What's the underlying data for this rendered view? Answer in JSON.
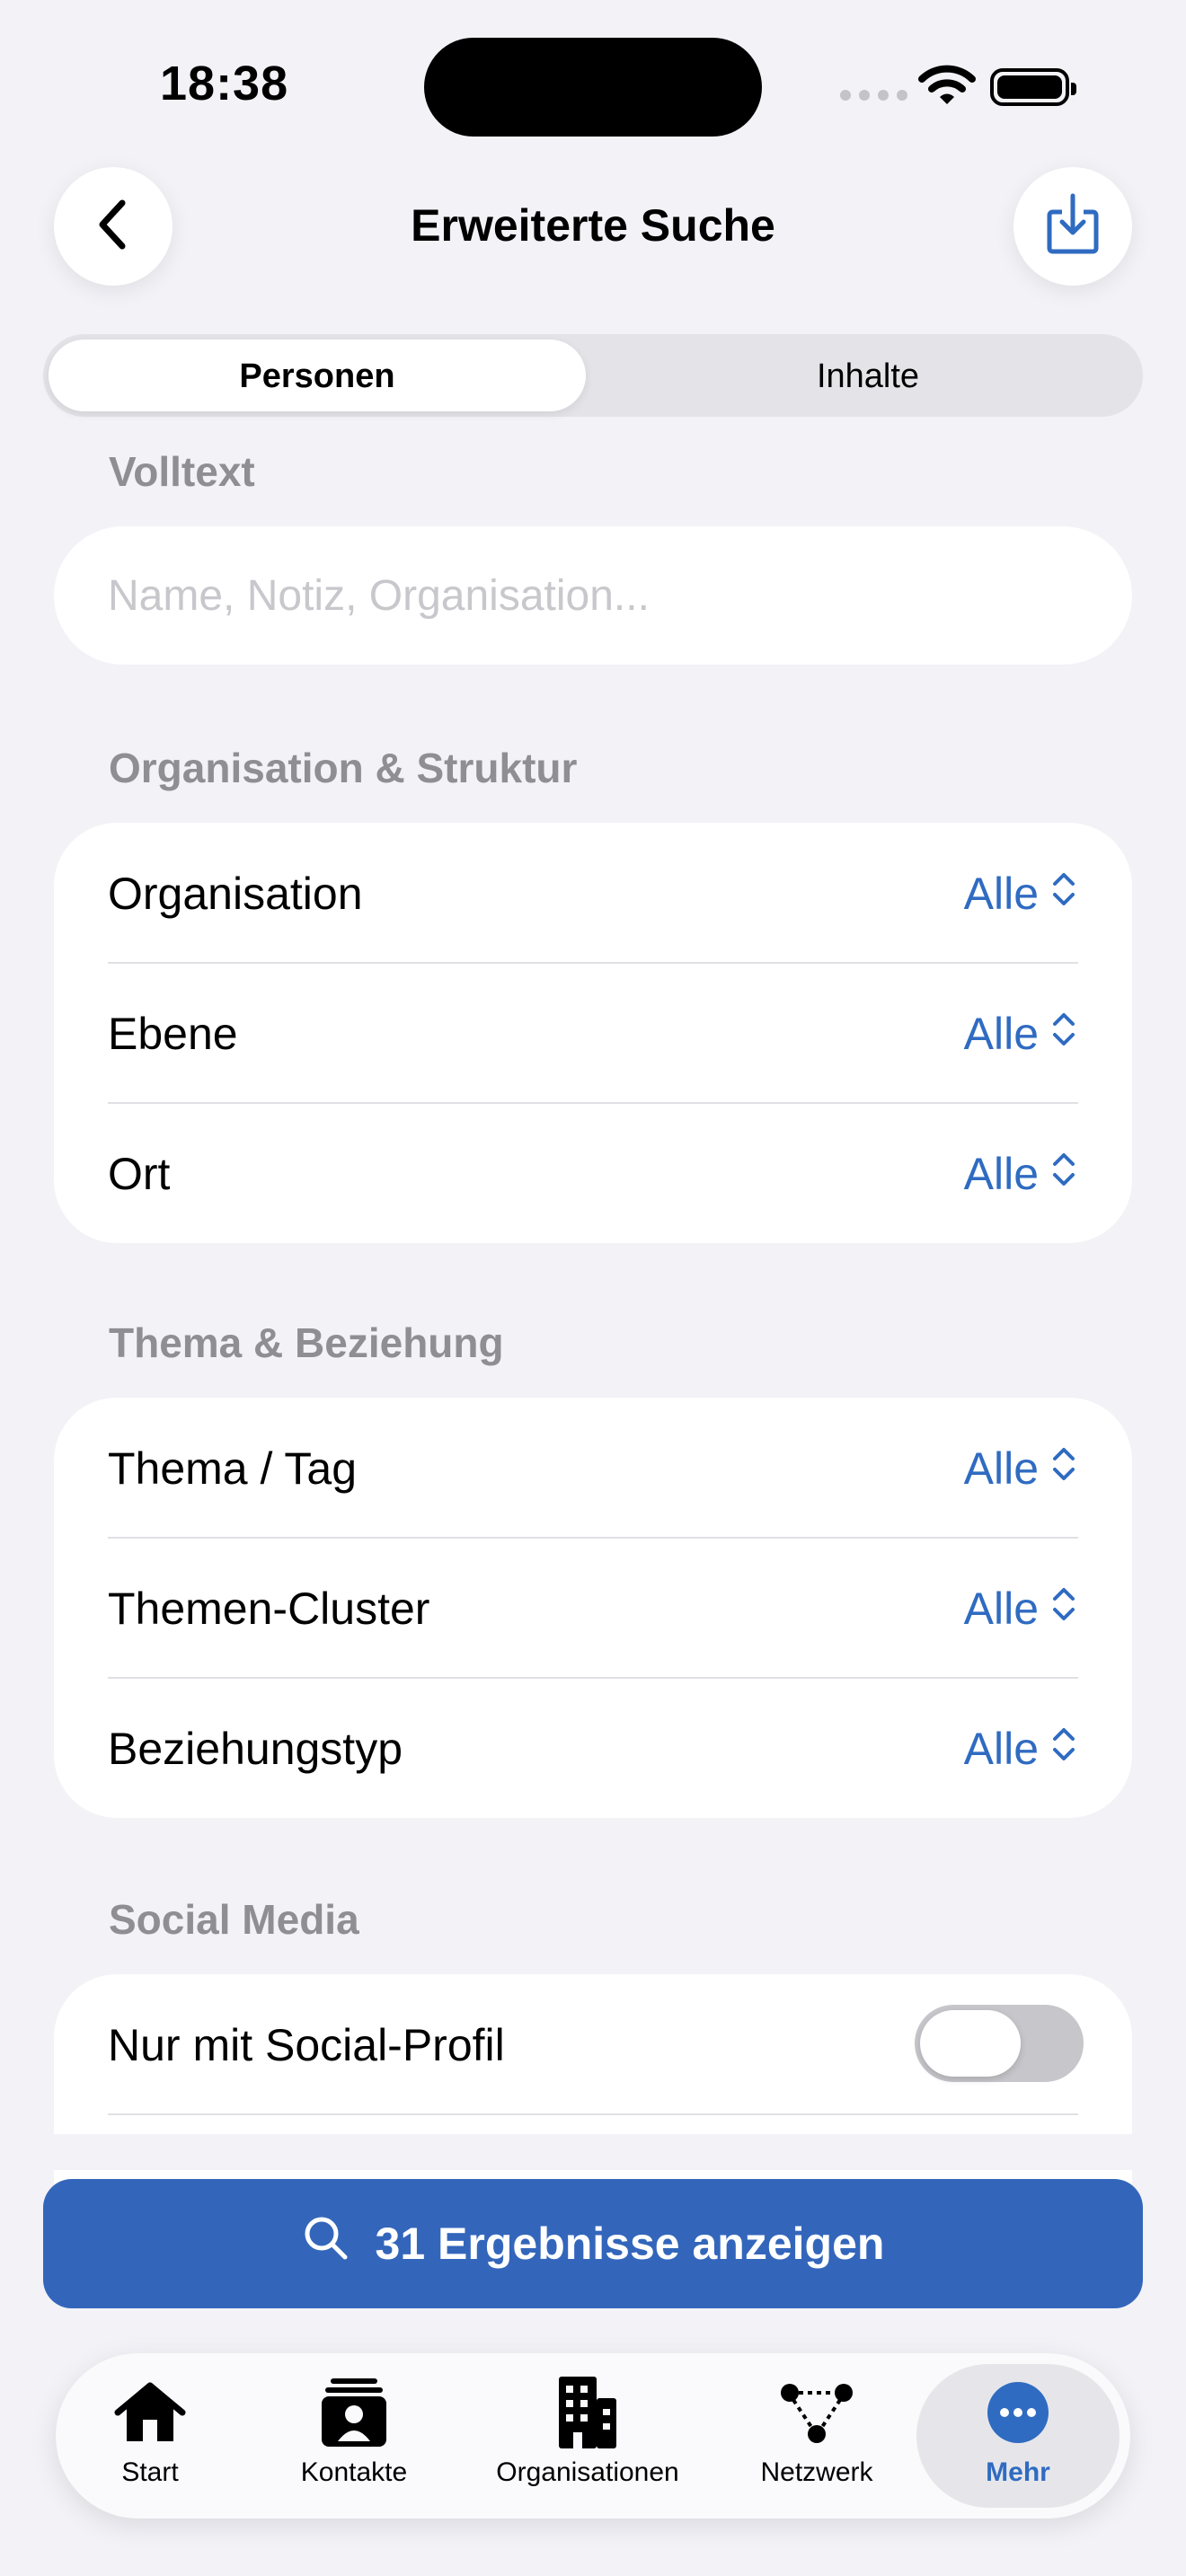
{
  "status_bar": {
    "time": "18:38"
  },
  "nav": {
    "title": "Erweiterte Suche",
    "back_icon": "chevron-left-icon",
    "export_icon": "tray-arrow-down-icon"
  },
  "segments": {
    "items": [
      {
        "label": "Personen",
        "selected": true
      },
      {
        "label": "Inhalte",
        "selected": false
      }
    ]
  },
  "fulltext": {
    "header": "Volltext",
    "placeholder": "Name, Notiz, Organisation...",
    "value": ""
  },
  "org_section": {
    "header": "Organisation & Struktur",
    "rows": [
      {
        "label": "Organisation",
        "value": "Alle"
      },
      {
        "label": "Ebene",
        "value": "Alle"
      },
      {
        "label": "Ort",
        "value": "Alle"
      }
    ]
  },
  "topic_section": {
    "header": "Thema & Beziehung",
    "rows": [
      {
        "label": "Thema / Tag",
        "value": "Alle"
      },
      {
        "label": "Themen-Cluster",
        "value": "Alle"
      },
      {
        "label": "Beziehungstyp",
        "value": "Alle"
      }
    ]
  },
  "social_section": {
    "header": "Social Media",
    "rows": [
      {
        "label": "Nur mit Social-Profil",
        "toggle_on": false
      }
    ]
  },
  "results_button": {
    "label": "31 Ergebnisse anzeigen",
    "icon": "search-icon"
  },
  "tabbar": {
    "items": [
      {
        "label": "Start",
        "icon": "house-icon"
      },
      {
        "label": "Kontakte",
        "icon": "contact-card-icon"
      },
      {
        "label": "Organisationen",
        "icon": "building-icon"
      },
      {
        "label": "Netzwerk",
        "icon": "network-icon"
      },
      {
        "label": "Mehr",
        "icon": "ellipsis-circle-icon",
        "selected": true
      }
    ]
  },
  "colors": {
    "accent": "#3366bb",
    "value_blue": "#2f6bc1",
    "background": "#f2f2f7",
    "secondary_text": "#8e8e93"
  }
}
